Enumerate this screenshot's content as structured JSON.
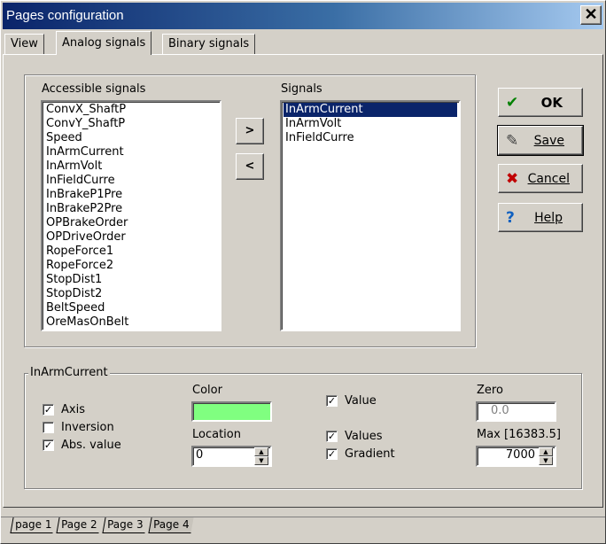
{
  "window": {
    "title": "Pages configuration",
    "close_label": "✕"
  },
  "tabs": [
    "View",
    "Analog signals",
    "Binary signals"
  ],
  "accessible": {
    "label": "Accessible signals",
    "items": [
      "ConvX_ShaftP",
      "ConvY_ShaftP",
      "Speed",
      "InArmCurrent",
      "InArmVolt",
      "InFieldCurre",
      "InBrakeP1Pre",
      "InBrakeP2Pre",
      "OPBrakeOrder",
      "OPDriveOrder",
      "RopeForce1",
      "RopeForce2",
      "StopDist1",
      "StopDist2",
      "BeltSpeed",
      "OreMasOnBelt"
    ]
  },
  "signals": {
    "label": "Signals",
    "items": [
      "InArmCurrent",
      "InArmVolt",
      "InFieldCurre"
    ],
    "selected_index": 0
  },
  "move_buttons": {
    "add": ">",
    "remove": "<"
  },
  "actions": {
    "ok": {
      "label": "OK",
      "icon": "✔"
    },
    "save": {
      "label": "Save",
      "icon": "✎"
    },
    "cancel": {
      "label": "Cancel",
      "icon": "✖"
    },
    "help": {
      "label": "Help",
      "icon": "?"
    }
  },
  "props": {
    "group_title": "InArmCurrent",
    "axis_label": "Axis",
    "axis_checked": true,
    "inversion_label": "Inversion",
    "inversion_checked": false,
    "abs_label": "Abs. value",
    "abs_checked": true,
    "color_label": "Color",
    "color_value": "#80ff80",
    "location_label": "Location",
    "location_value": "0",
    "value_label": "Value",
    "value_checked": true,
    "values_label": "Values",
    "values_checked": true,
    "gradient_label": "Gradient",
    "gradient_checked": true,
    "zero_label": "Zero",
    "zero_value": "0.0",
    "max_label": "Max [16383.5]",
    "max_value": "7000"
  },
  "pages": [
    "page 1",
    "Page 2",
    "Page 3",
    "Page 4"
  ],
  "active_page": 3,
  "colors": {
    "title_start": "#0a246a",
    "title_end": "#a6caf0",
    "selection": "#0a246a"
  }
}
